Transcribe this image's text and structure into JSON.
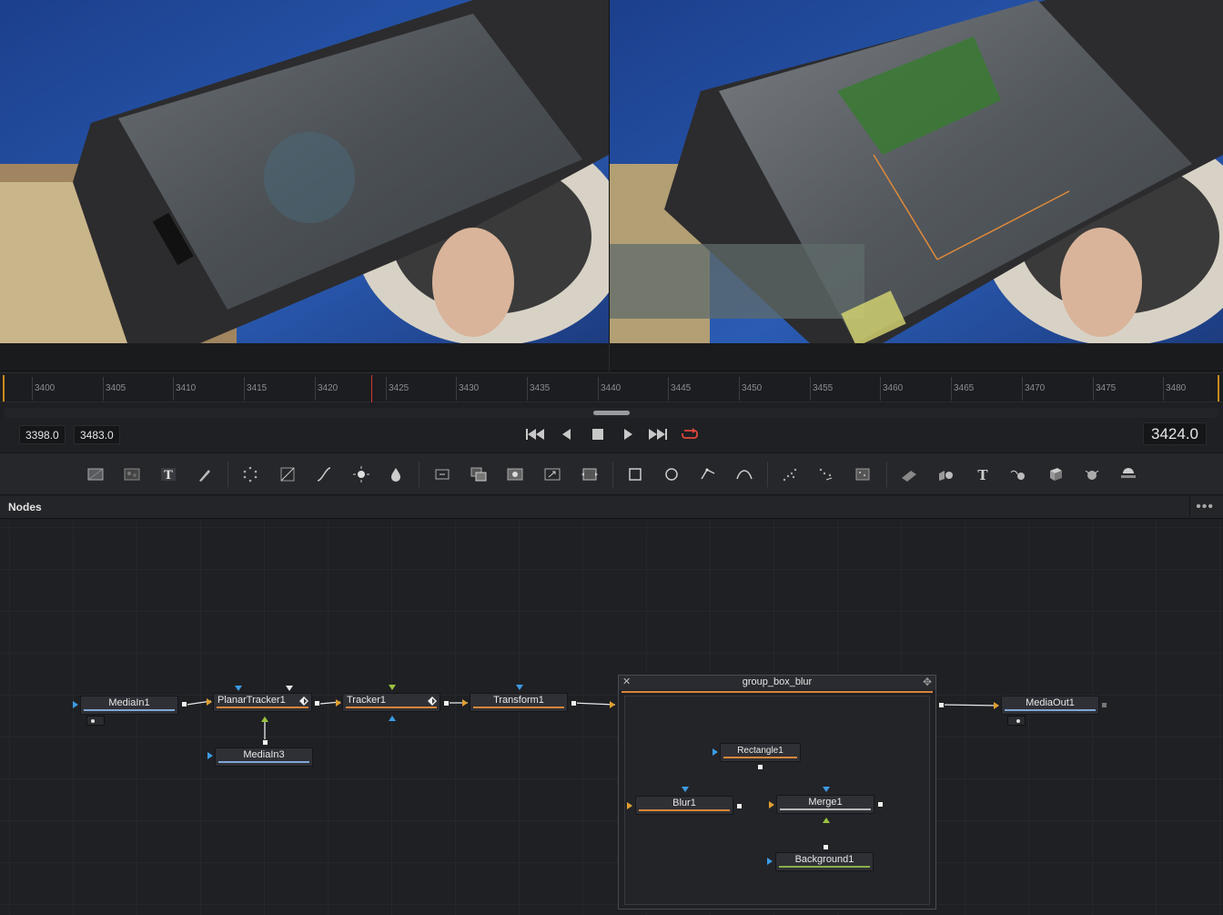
{
  "viewers": {
    "left": {
      "name": "viewer-left"
    },
    "right": {
      "name": "viewer-right"
    }
  },
  "timeline": {
    "ticks": [
      "3400",
      "3405",
      "3410",
      "3415",
      "3420",
      "3425",
      "3430",
      "3435",
      "3440",
      "3445",
      "3450",
      "3455",
      "3460",
      "3465",
      "3470",
      "3475",
      "3480"
    ],
    "playhead_color": "#d23a2f",
    "range_color": "#c98a1b"
  },
  "transport": {
    "range_start": "3398.0",
    "range_end": "3483.0",
    "current_frame": "3424.0",
    "loop_color": "#e0473a"
  },
  "toolbar": {
    "tools": [
      "background-icon",
      "fast-noise-icon",
      "text-icon",
      "paint-icon",
      "particles-icon",
      "color-corrector-icon",
      "color-curves-icon",
      "brightness-contrast-icon",
      "blur-icon",
      "loader-icon",
      "merge-icon",
      "matte-control-icon",
      "resize-icon",
      "transform-icon",
      "rectangle-mask-icon",
      "ellipse-mask-icon",
      "polygon-mask-icon",
      "bspline-mask-icon",
      "pemitter-icon",
      "prender-icon",
      "pkill-icon",
      "shape3d-icon",
      "merge3d-icon",
      "text3d-icon",
      "camera3d-icon",
      "renderer3d-icon",
      "light-icon",
      "fog-icon"
    ]
  },
  "nodes_panel": {
    "title": "Nodes",
    "menu": "•••"
  },
  "nodes": {
    "mediain1": "MediaIn1",
    "planartracker1": "PlanarTracker1",
    "tracker1": "Tracker1",
    "transform1": "Transform1",
    "mediain3": "MediaIn3",
    "mediaout1": "MediaOut1",
    "group_name": "group_box_blur",
    "rectangle1": "Rectangle1",
    "blur1": "Blur1",
    "merge1": "Merge1",
    "background1": "Background1"
  },
  "icons": {
    "group_close": "✕",
    "group_move": "✥"
  }
}
